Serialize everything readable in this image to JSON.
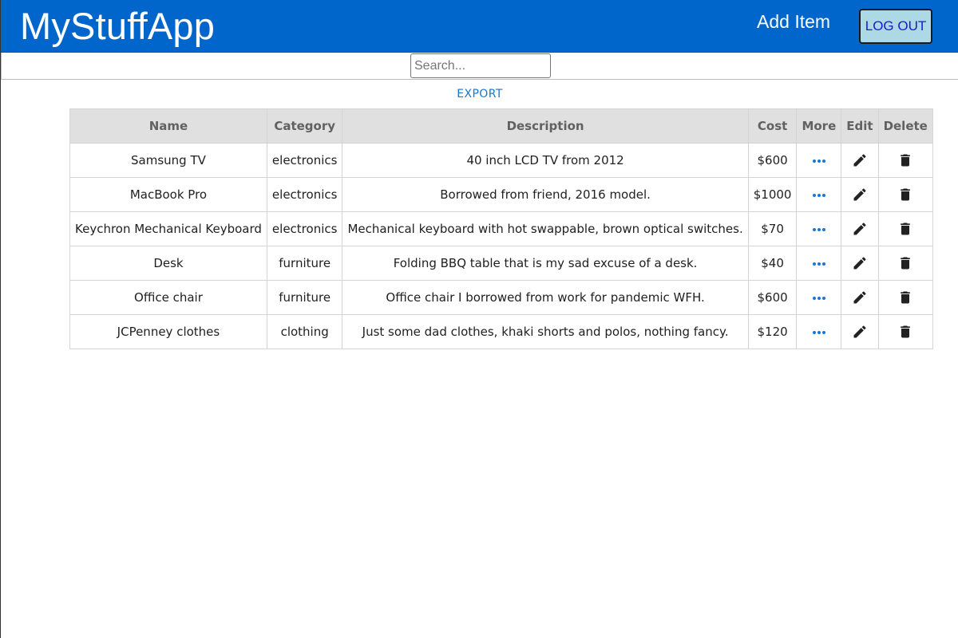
{
  "header": {
    "brand": "MyStuffApp",
    "add_item_label": "Add Item",
    "logout_label": "LOG OUT"
  },
  "search": {
    "placeholder": "Search...",
    "value": ""
  },
  "export_label": "EXPORT",
  "table": {
    "columns": [
      "Name",
      "Category",
      "Description",
      "Cost",
      "More",
      "Edit",
      "Delete"
    ],
    "rows": [
      {
        "name": "Samsung TV",
        "category": "electronics",
        "description": "40 inch LCD TV from 2012",
        "cost": "$600"
      },
      {
        "name": "MacBook Pro",
        "category": "electronics",
        "description": "Borrowed from friend, 2016 model.",
        "cost": "$1000"
      },
      {
        "name": "Keychron Mechanical Keyboard",
        "category": "electronics",
        "description": "Mechanical keyboard with hot swappable, brown optical switches.",
        "cost": "$70"
      },
      {
        "name": "Desk",
        "category": "furniture",
        "description": "Folding BBQ table that is my sad excuse of a desk.",
        "cost": "$40"
      },
      {
        "name": "Office chair",
        "category": "furniture",
        "description": "Office chair I borrowed from work for pandemic WFH.",
        "cost": "$600"
      },
      {
        "name": "JCPenney clothes",
        "category": "clothing",
        "description": "Just some dad clothes, khaki shorts and polos, nothing fancy.",
        "cost": "$120"
      }
    ]
  },
  "icons": {
    "more": "more-horizontal-icon",
    "edit": "pencil-icon",
    "delete": "trash-icon"
  },
  "colors": {
    "header_bg": "#0066cc",
    "logout_bg": "#add8e6",
    "accent": "#1976d2",
    "table_header_bg": "#e0e0e0"
  }
}
